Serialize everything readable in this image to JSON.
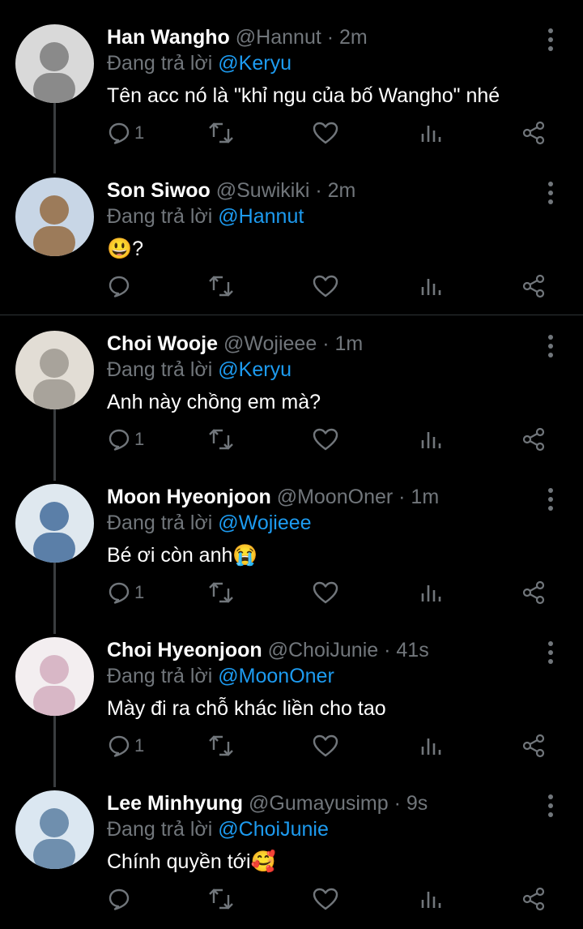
{
  "replying_prefix": "Đang trả lời",
  "tweets": [
    {
      "name": "Han Wangho",
      "handle": "@Hannut",
      "time": "· 2m",
      "reply_to": "@Keryu",
      "text": "Tên acc nó là \"khỉ ngu của bố Wangho\" nhé",
      "reply_count": "1",
      "avatar_colors": [
        "#8a8a8a",
        "#d9d9d9"
      ]
    },
    {
      "name": "Son Siwoo",
      "handle": "@Suwikiki",
      "time": "· 2m",
      "reply_to": "@Hannut",
      "text": "😃?",
      "reply_count": "",
      "avatar_colors": [
        "#9c7b5a",
        "#c8d6e6"
      ]
    },
    {
      "name": "Choi Wooje",
      "handle": "@Wojieee",
      "time": "· 1m",
      "reply_to": "@Keryu",
      "text": "Anh này chồng em mà?",
      "reply_count": "1",
      "avatar_colors": [
        "#a8a39b",
        "#e2ddd5"
      ]
    },
    {
      "name": "Moon Hyeonjoon",
      "handle": "@MoonOner",
      "time": "· 1m",
      "reply_to": "@Wojieee",
      "text": "Bé ơi còn anh😭",
      "reply_count": "1",
      "avatar_colors": [
        "#5b7fa8",
        "#dfe8ef"
      ]
    },
    {
      "name": "Choi Hyeonjoon",
      "handle": "@ChoiJunie",
      "time": "· 41s",
      "reply_to": "@MoonOner",
      "text": "Mày đi ra chỗ khác liền cho tao",
      "reply_count": "1",
      "avatar_colors": [
        "#d8b7c6",
        "#f3eef0"
      ]
    },
    {
      "name": "Lee Minhyung",
      "handle": "@Gumayusimp",
      "time": "· 9s",
      "reply_to": "@ChoiJunie",
      "text": "Chính quyền tới🥰",
      "reply_count": "",
      "avatar_colors": [
        "#6f8fae",
        "#dbe7f1"
      ]
    }
  ],
  "icons": {
    "reply": "reply-icon",
    "retweet": "retweet-icon",
    "like": "heart-icon",
    "views": "views-icon",
    "share": "share-icon",
    "more": "more-icon"
  }
}
